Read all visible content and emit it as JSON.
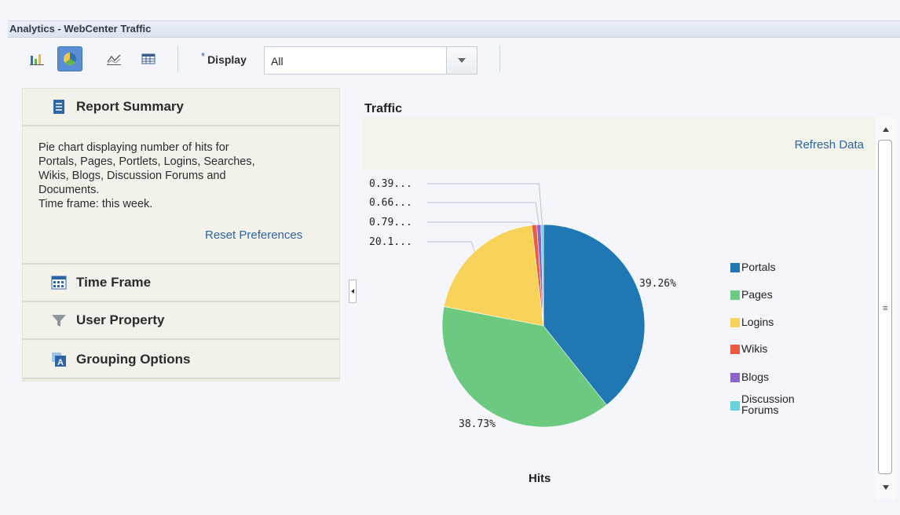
{
  "window": {
    "title": "Analytics - WebCenter Traffic"
  },
  "toolbar": {
    "view_buttons": [
      "bar-chart-view",
      "pie-chart-view",
      "line-chart-view",
      "table-view"
    ],
    "display_required_marker": "*",
    "display_label": "Display",
    "display_value": "All"
  },
  "left_panel": {
    "sections": [
      {
        "label": "Report Summary",
        "expanded": true
      },
      {
        "label": "Time Frame",
        "expanded": false
      },
      {
        "label": "User Property",
        "expanded": false
      },
      {
        "label": "Grouping Options",
        "expanded": false
      }
    ],
    "summary_lines": [
      "Pie chart displaying number of hits for",
      "Portals, Pages, Portlets, Logins, Searches,",
      "Wikis, Blogs, Discussion Forums and",
      "Documents.",
      "Time frame: this week."
    ],
    "reset_link": "Reset Preferences"
  },
  "report": {
    "title": "Traffic",
    "refresh_link": "Refresh Data",
    "footer_label": "Hits"
  },
  "chart_data": {
    "type": "pie",
    "categories": [
      "Portals",
      "Pages",
      "Logins",
      "Wikis",
      "Blogs",
      "Discussion Forums"
    ],
    "values": [
      39.26,
      38.73,
      20.1,
      0.79,
      0.66,
      0.39
    ],
    "colors": [
      "#1f77b4",
      "#6cc980",
      "#f9d25a",
      "#ec5a41",
      "#8c63c9",
      "#67d3dc"
    ],
    "slice_labels": [
      "39.26%",
      "38.73%",
      "20.1...",
      "0.79...",
      "0.66...",
      "0.39..."
    ],
    "xlabel": "Hits",
    "legend": "right"
  }
}
